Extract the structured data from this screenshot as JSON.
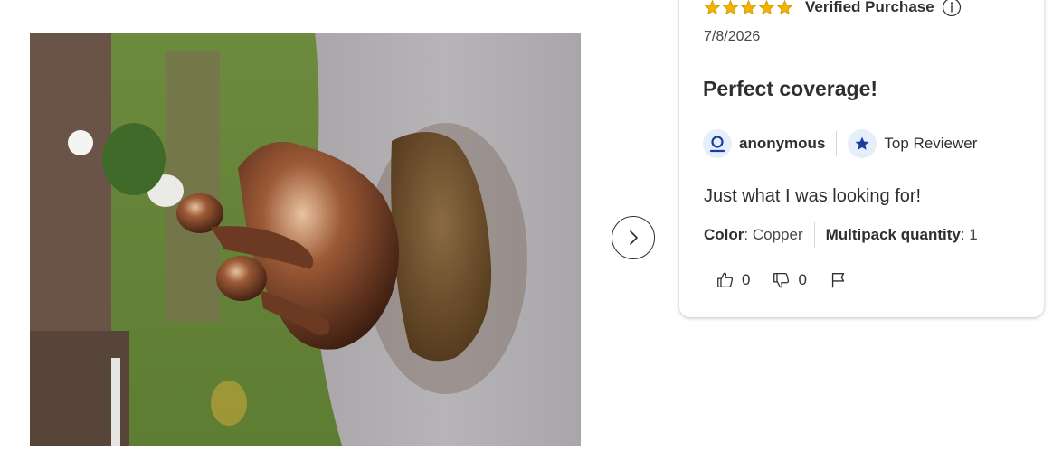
{
  "review": {
    "rating": 5,
    "rating_max": 5,
    "verified_label": "Verified Purchase",
    "date": "7/8/2026",
    "title": "Perfect coverage!",
    "author": "anonymous",
    "badge_label": "Top Reviewer",
    "body": "Just what I was looking for!",
    "attributes": [
      {
        "name": "Color",
        "value": "Copper"
      },
      {
        "name": "Multipack quantity",
        "value": "1"
      }
    ],
    "helpful_count": "0",
    "unhelpful_count": "0"
  },
  "icons": {
    "star": "star-icon",
    "info": "info-icon",
    "user": "user-icon",
    "top_reviewer": "star-badge-icon",
    "thumbs_up": "thumbs-up-icon",
    "thumbs_down": "thumbs-down-icon",
    "flag": "flag-icon",
    "next": "chevron-right-icon"
  },
  "colors": {
    "star": "#f2b200",
    "text": "#2e2f32",
    "badge_blue": "#1a3e9f",
    "badge_bg": "#e6eefb"
  }
}
